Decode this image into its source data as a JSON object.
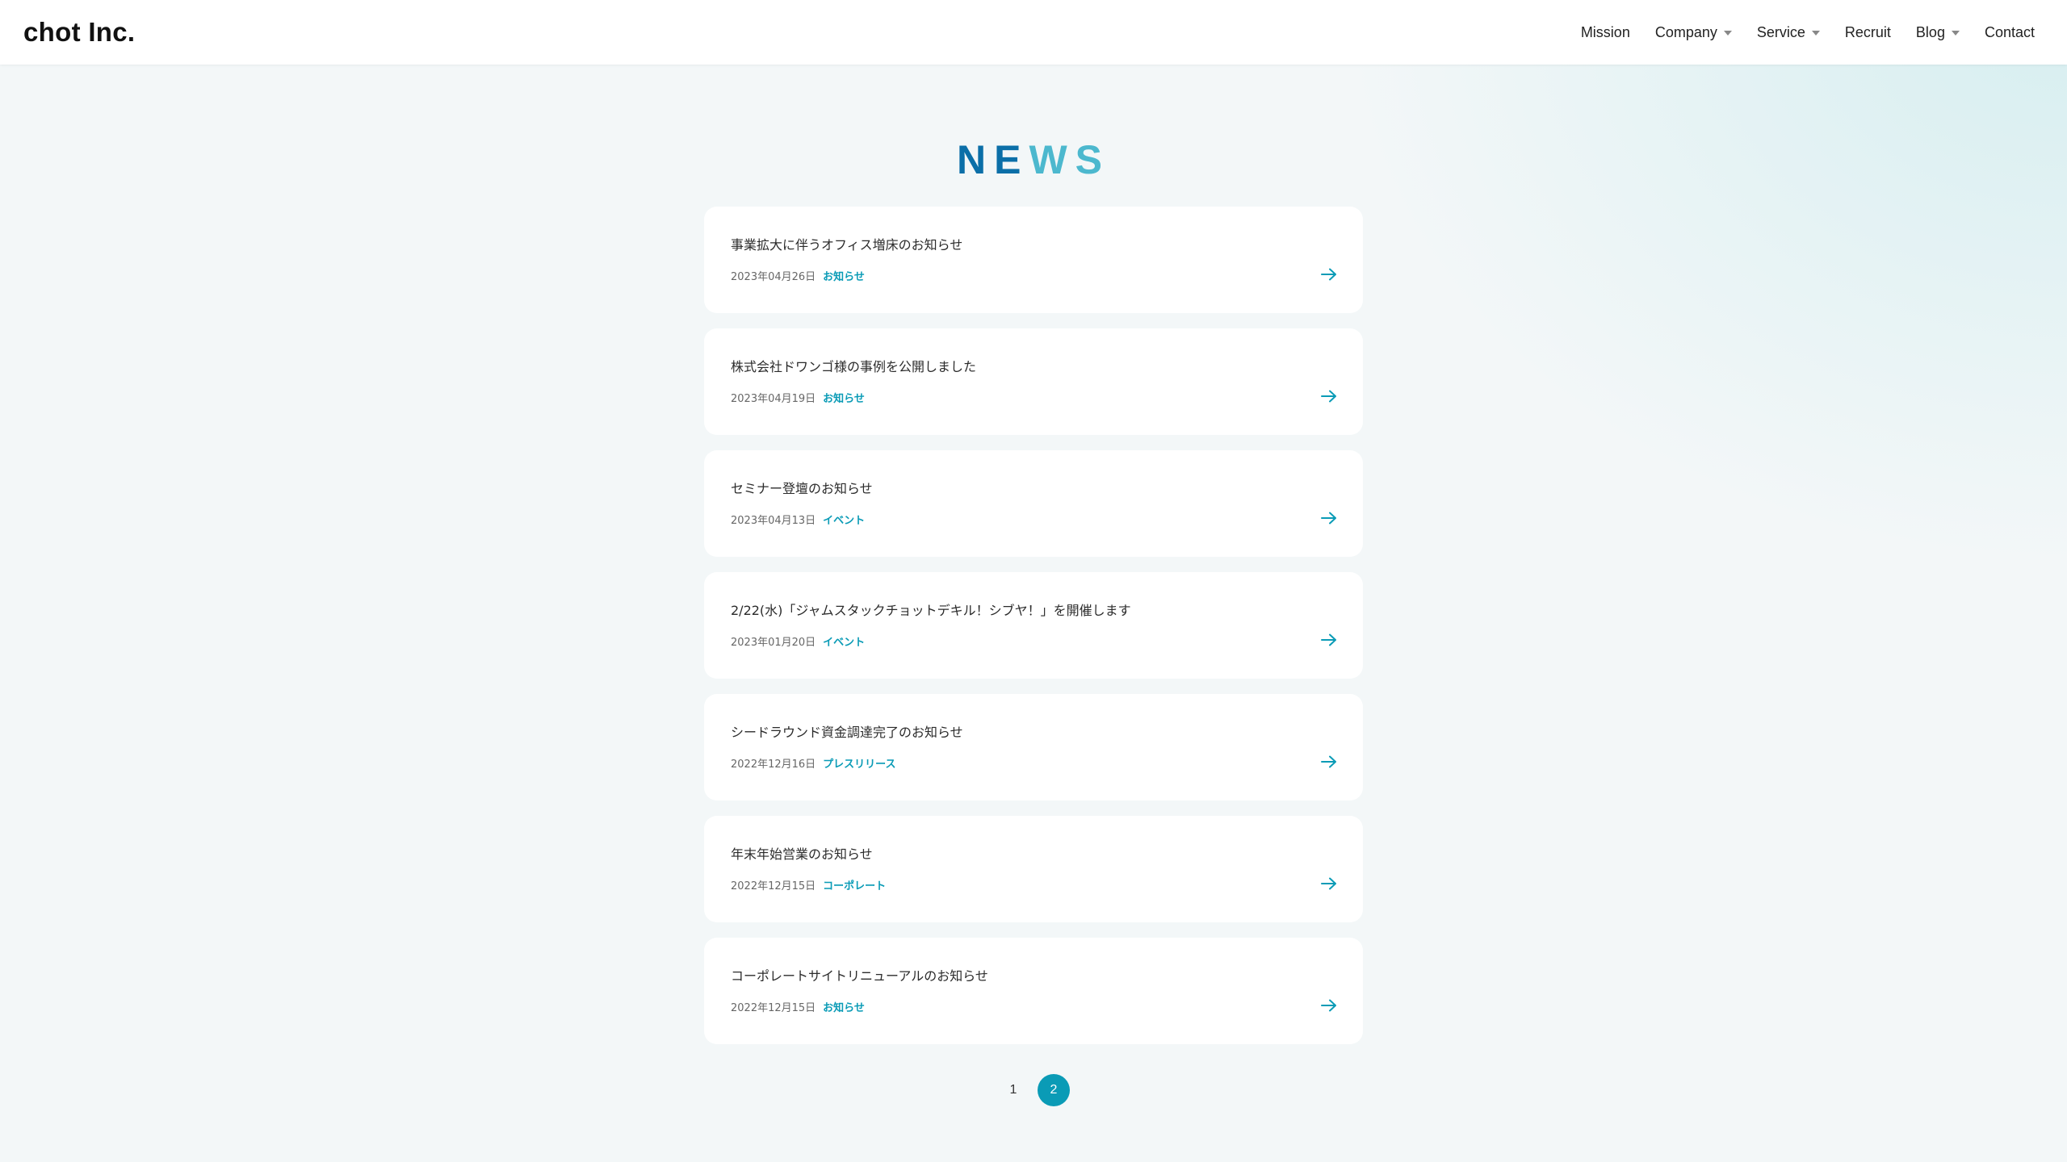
{
  "header": {
    "logo": "chot Inc.",
    "nav": [
      {
        "label": "Mission",
        "dropdown": false
      },
      {
        "label": "Company",
        "dropdown": true
      },
      {
        "label": "Service",
        "dropdown": true
      },
      {
        "label": "Recruit",
        "dropdown": false
      },
      {
        "label": "Blog",
        "dropdown": true
      },
      {
        "label": "Contact",
        "dropdown": false
      }
    ]
  },
  "main": {
    "title_dark": "NE",
    "title_light": "WS",
    "news": [
      {
        "title": "事業拡大に伴うオフィス増床のお知らせ",
        "date": "2023年04月26日",
        "category": "お知らせ"
      },
      {
        "title": "株式会社ドワンゴ様の事例を公開しました",
        "date": "2023年04月19日",
        "category": "お知らせ"
      },
      {
        "title": "セミナー登壇のお知らせ",
        "date": "2023年04月13日",
        "category": "イベント"
      },
      {
        "title": "2/22(水)「ジャムスタックチョットデキル！シブヤ！」を開催します",
        "date": "2023年01月20日",
        "category": "イベント"
      },
      {
        "title": "シードラウンド資金調達完了のお知らせ",
        "date": "2022年12月16日",
        "category": "プレスリリース"
      },
      {
        "title": "年末年始営業のお知らせ",
        "date": "2022年12月15日",
        "category": "コーポレート"
      },
      {
        "title": "コーポレートサイトリニューアルのお知らせ",
        "date": "2022年12月15日",
        "category": "お知らせ"
      }
    ],
    "pagination": {
      "pages": [
        "1",
        "2"
      ],
      "current": "2"
    }
  },
  "colors": {
    "accent": "#0a9bb6",
    "title_dark": "#0b6fa8",
    "title_light": "#4cb8ce",
    "background": "#f3f7f8"
  },
  "icons": {
    "card_arrow": "arrow-right-icon",
    "nav_caret": "caret-down-icon"
  }
}
